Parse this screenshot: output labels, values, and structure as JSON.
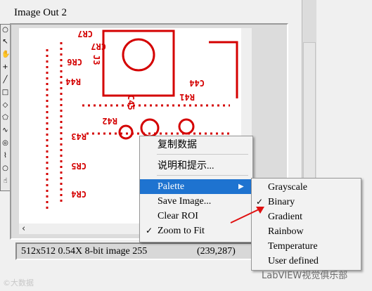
{
  "window": {
    "title": "Image Out 2"
  },
  "status": {
    "info": "512x512 0.54X 8-bit image 255",
    "coords": "(239,287)"
  },
  "context_menu": {
    "items": [
      {
        "label": "复制数据",
        "checked": false,
        "has_submenu": false,
        "highlighted": false
      },
      {
        "label": "说明和提示...",
        "checked": false,
        "has_submenu": false,
        "highlighted": false
      },
      {
        "label": "Palette",
        "checked": false,
        "has_submenu": true,
        "highlighted": true
      },
      {
        "label": "Save Image...",
        "checked": false,
        "has_submenu": false,
        "highlighted": false
      },
      {
        "label": "Clear ROI",
        "checked": false,
        "has_submenu": false,
        "highlighted": false
      },
      {
        "label": "Zoom to Fit",
        "checked": true,
        "has_submenu": false,
        "highlighted": false
      }
    ],
    "check_glyph": "✓",
    "submenu_arrow": "▶"
  },
  "palette_submenu": {
    "items": [
      {
        "label": "Grayscale",
        "checked": false
      },
      {
        "label": "Binary",
        "checked": true
      },
      {
        "label": "Gradient",
        "checked": false
      },
      {
        "label": "Rainbow",
        "checked": false
      },
      {
        "label": "Temperature",
        "checked": false
      },
      {
        "label": "User defined",
        "checked": false
      }
    ]
  },
  "pcb_labels": [
    "CR7",
    "J3",
    "CR6",
    "R44",
    "C44",
    "C45",
    "R41",
    "R42",
    "R43",
    "CR5",
    "CR4"
  ],
  "watermark": {
    "left": "©大数据",
    "right": "LabVIEW视觉俱乐部"
  },
  "colors": {
    "menu_highlight": "#1e73d0",
    "pcb_red": "#d40000",
    "arrow_red": "#e01010"
  },
  "icons": [
    "oval-tool-icon",
    "pointer-icon",
    "hand-icon",
    "crosshair-icon",
    "line-icon",
    "rectangle-icon",
    "rotated-rect-icon",
    "polygon-icon",
    "freehand-icon",
    "annulus-icon",
    "broken-line-icon",
    "zoom-icon",
    "pan-icon"
  ]
}
